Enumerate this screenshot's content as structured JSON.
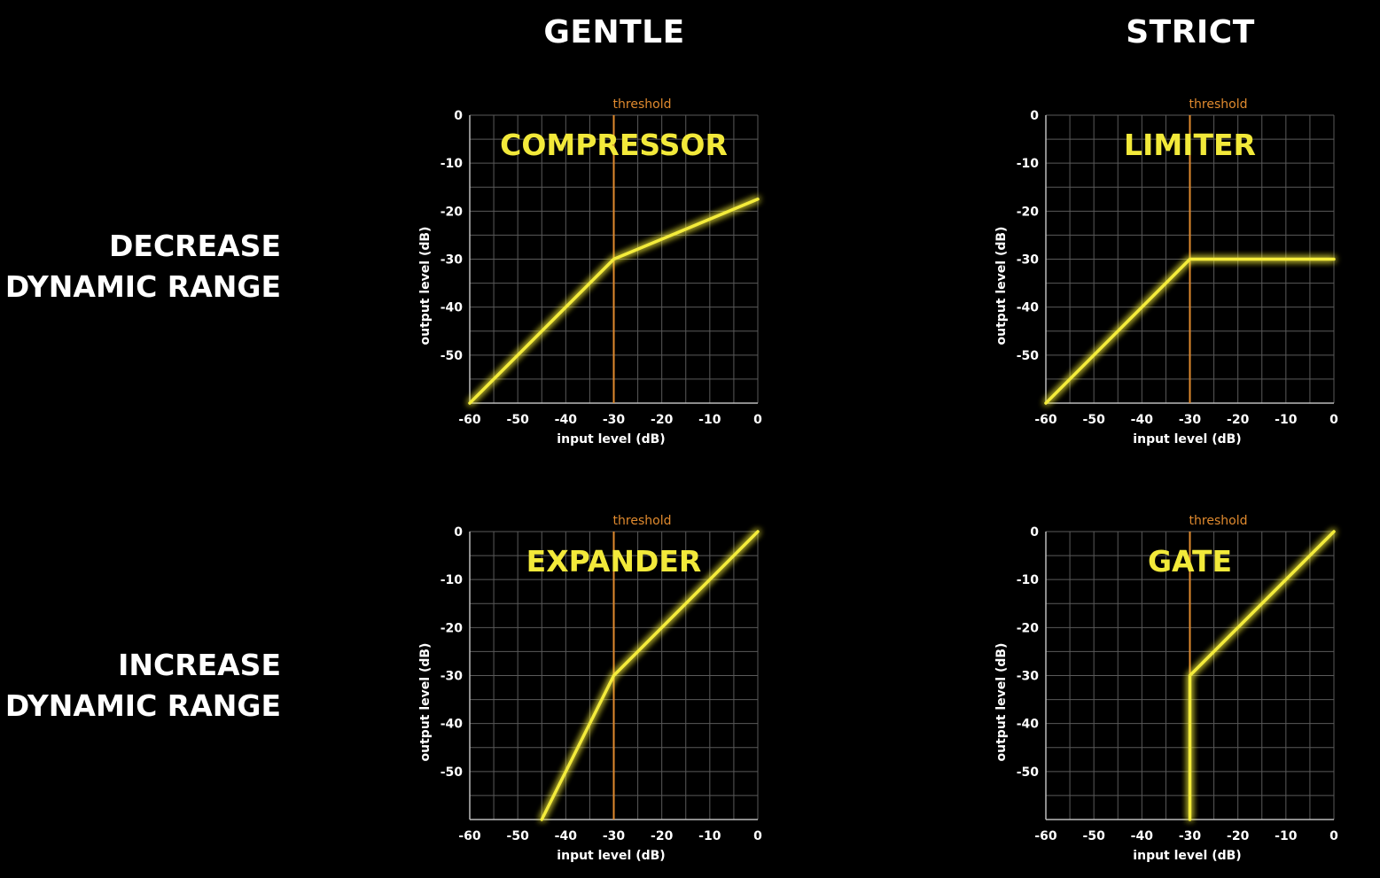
{
  "columns": [
    "GENTLE",
    "STRICT"
  ],
  "rows": [
    {
      "line1": "DECREASE",
      "line2": "DYNAMIC RANGE"
    },
    {
      "line1": "INCREASE",
      "line2": "DYNAMIC RANGE"
    }
  ],
  "colors": {
    "curve": "#f4ec3a",
    "threshold": "#e08a2e",
    "grid": "#5a5a5a",
    "background": "#000000"
  },
  "chart_data": [
    {
      "type": "line",
      "title": "COMPRESSOR",
      "xlabel": "input level (dB)",
      "ylabel": "output level (dB)",
      "xlim": [
        -60,
        0
      ],
      "ylim": [
        -60,
        0
      ],
      "grid": true,
      "threshold": -30,
      "threshold_label": "threshold",
      "x_ticks": [
        -60,
        -50,
        -40,
        -30,
        -20,
        -10,
        0
      ],
      "y_ticks": [
        0,
        -10,
        -20,
        -30,
        -40,
        -50
      ],
      "series": [
        {
          "x": [
            -60,
            -30,
            0
          ],
          "y": [
            -60,
            -30,
            -17.5
          ]
        }
      ]
    },
    {
      "type": "line",
      "title": "LIMITER",
      "xlabel": "input level (dB)",
      "ylabel": "output level (dB)",
      "xlim": [
        -60,
        0
      ],
      "ylim": [
        -60,
        0
      ],
      "grid": true,
      "threshold": -30,
      "threshold_label": "threshold",
      "x_ticks": [
        -60,
        -50,
        -40,
        -30,
        -20,
        -10,
        0
      ],
      "y_ticks": [
        0,
        -10,
        -20,
        -30,
        -40,
        -50
      ],
      "series": [
        {
          "x": [
            -60,
            -30,
            0
          ],
          "y": [
            -60,
            -30,
            -30
          ]
        }
      ]
    },
    {
      "type": "line",
      "title": "EXPANDER",
      "xlabel": "input level (dB)",
      "ylabel": "output level (dB)",
      "xlim": [
        -60,
        0
      ],
      "ylim": [
        -60,
        0
      ],
      "grid": true,
      "threshold": -30,
      "threshold_label": "threshold",
      "x_ticks": [
        -60,
        -50,
        -40,
        -30,
        -20,
        -10,
        0
      ],
      "y_ticks": [
        0,
        -10,
        -20,
        -30,
        -40,
        -50
      ],
      "series": [
        {
          "x": [
            -45,
            -30,
            0
          ],
          "y": [
            -60,
            -30,
            0
          ]
        }
      ]
    },
    {
      "type": "line",
      "title": "GATE",
      "xlabel": "input level (dB)",
      "ylabel": "output level (dB)",
      "xlim": [
        -60,
        0
      ],
      "ylim": [
        -60,
        0
      ],
      "grid": true,
      "threshold": -30,
      "threshold_label": "threshold",
      "x_ticks": [
        -60,
        -50,
        -40,
        -30,
        -20,
        -10,
        0
      ],
      "y_ticks": [
        0,
        -10,
        -20,
        -30,
        -40,
        -50
      ],
      "series": [
        {
          "x": [
            -30,
            -30,
            0
          ],
          "y": [
            -60,
            -30,
            0
          ]
        }
      ]
    }
  ]
}
